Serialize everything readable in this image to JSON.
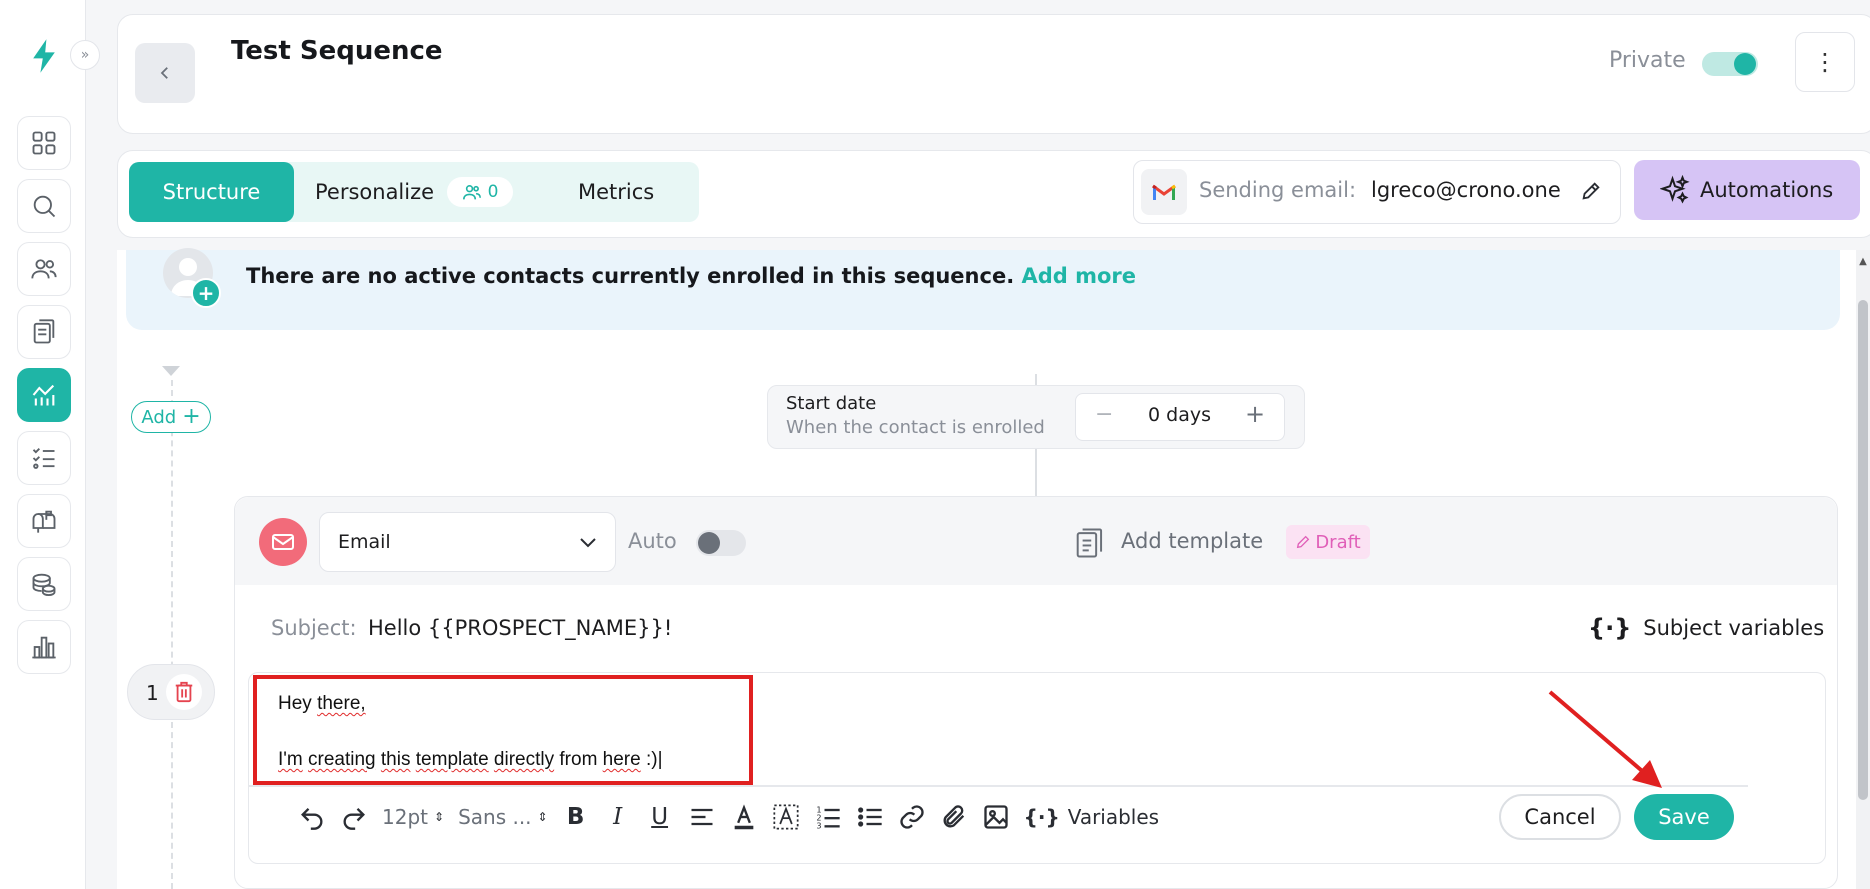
{
  "header": {
    "title": "Test Sequence",
    "private_label": "Private",
    "kebab": "⋮"
  },
  "tabs": {
    "structure": "Structure",
    "personalize": "Personalize",
    "personalize_count": "0",
    "metrics": "Metrics"
  },
  "sending": {
    "label": "Sending email:",
    "value": "lgreco@crono.one"
  },
  "automations_label": "Automations",
  "banner": {
    "text": "There are no active contacts currently enrolled in this sequence.",
    "link": "Add more"
  },
  "add_label": "Add",
  "start_date": {
    "title": "Start date",
    "subtitle": "When the contact is enrolled",
    "value": "0 days"
  },
  "step": {
    "number": "1",
    "type": "Email",
    "auto_label": "Auto",
    "auto_on": false,
    "add_template": "Add template",
    "draft": "Draft",
    "subject_label": "Subject:",
    "subject_value": "Hello {{PROSPECT_NAME}}!",
    "subject_vars": "Subject variables",
    "body": {
      "line1_word1": "Hey",
      "line1_word2": "there,",
      "line2_w1": "I'm",
      "line2_w2": "creating",
      "line2_w3": "this",
      "line2_w4": "template",
      "line2_w5": "directly",
      "line2_w6": "from",
      "line2_w7": "here",
      "line2_w8": ":)"
    }
  },
  "toolbar": {
    "font_size": "12pt",
    "font_family": "Sans ...",
    "variables": "Variables",
    "cancel": "Cancel",
    "save": "Save"
  },
  "colors": {
    "accent": "#1fb5a6",
    "automations_bg": "#d6c4f5",
    "email_icon": "#f26b7a",
    "annotation_red": "#e02020"
  },
  "icons": [
    "bolt-icon",
    "grid-icon",
    "search-icon",
    "users-icon",
    "templates-icon",
    "sequences-icon",
    "tasks-icon",
    "mailbox-icon",
    "deals-icon",
    "analytics-icon"
  ]
}
